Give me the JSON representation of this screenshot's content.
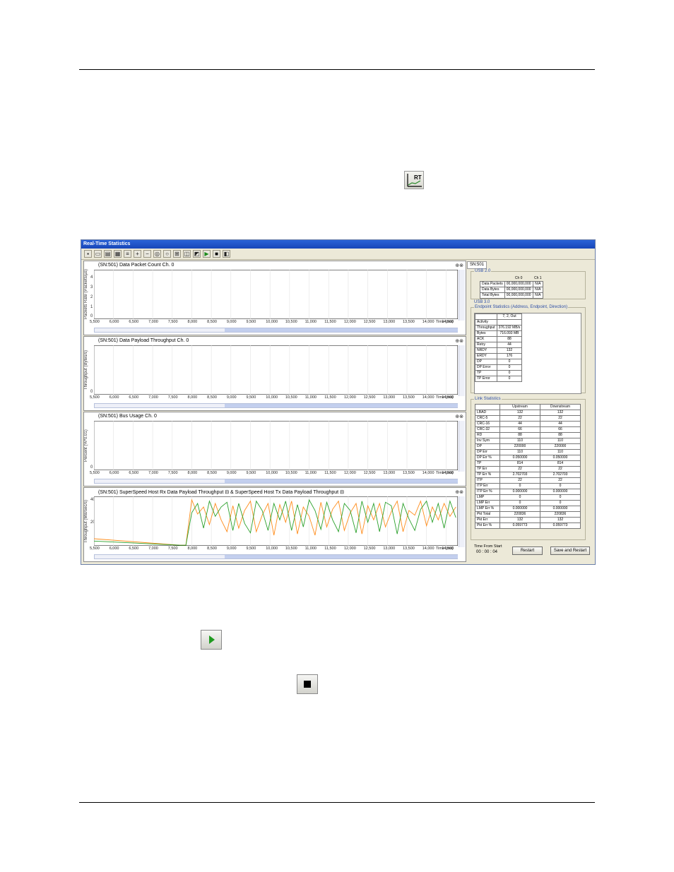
{
  "window": {
    "title": "Real-Time Statistics",
    "tab": "SN:501"
  },
  "x_ticks": [
    "5,500",
    "6,000",
    "6,500",
    "7,000",
    "7,500",
    "8,000",
    "8,500",
    "9,000",
    "9,500",
    "10,000",
    "10,500",
    "11,000",
    "11,500",
    "12,000",
    "12,500",
    "13,000",
    "13,500",
    "14,000",
    "14,500"
  ],
  "x_unit_label": "Time (ms)",
  "panels": [
    {
      "title": "(SN:501) Data Packet Count Ch. 0",
      "ylabel": "Packets Rate (Packets/µs)"
    },
    {
      "title": "(SN:501) Data Payload Throughput Ch. 0",
      "ylabel": "Throughput (Bytes/s)"
    },
    {
      "title": "(SN:501) Bus Usage Ch. 0",
      "ylabel": "Percent (%*0.01)"
    },
    {
      "title": "(SN:501) SuperSpeed Host Rx Data Payload Throughput ⊟ & SuperSpeed Host Tx Data Payload Throughput ⊟",
      "ylabel": "Throughput (MB/sec/s)"
    }
  ],
  "usb20": {
    "label": "USB 2.0",
    "headers": [
      "",
      "Ch 0",
      "Ch 1"
    ],
    "rows": [
      [
        "Data Packets",
        "00,000,000,000",
        "N/A"
      ],
      [
        "Data Bytes",
        "00,000,000,000",
        "N/A"
      ],
      [
        "Total Bytes",
        "00,000,000,000",
        "N/A"
      ]
    ]
  },
  "usb30": {
    "label": "USB 3.0",
    "endpoint_label": "Endpoint Statistics (Address, Endpoint, Direction)",
    "endpoint_header": "7, 2, Out",
    "endpoint_rows": [
      [
        "Activity",
        ""
      ],
      [
        "Throughput",
        "376.192 MB/s"
      ],
      [
        "Bytes",
        "716.093 MB"
      ],
      [
        "ACK",
        "88"
      ],
      [
        "Retry",
        "44"
      ],
      [
        "NRDY",
        "132"
      ],
      [
        "ERDY",
        "176"
      ],
      [
        "DP",
        "0"
      ],
      [
        "DP Error",
        "0"
      ],
      [
        "TP",
        "0"
      ],
      [
        "TP Error",
        "0"
      ]
    ],
    "link_label": "Link Statistics",
    "link_headers": [
      "",
      "Upstream",
      "Downstream"
    ],
    "link_rows": [
      [
        "LBAD",
        "132",
        "132"
      ],
      [
        "CRC-5",
        "22",
        "22"
      ],
      [
        "CRC-16",
        "44",
        "44"
      ],
      [
        "CRC-32",
        "66",
        "66"
      ],
      [
        "RD",
        "88",
        "88"
      ],
      [
        "Inv Sym",
        "110",
        "110"
      ],
      [
        "DP",
        "220000",
        "220000"
      ],
      [
        "DP Err",
        "110",
        "110"
      ],
      [
        "DP Err %",
        "0.050000",
        "0.050000"
      ],
      [
        "TP",
        "814",
        "814"
      ],
      [
        "TP Err",
        "22",
        "22"
      ],
      [
        "TP Err %",
        "2.702703",
        "2.702703"
      ],
      [
        "ITP",
        "22",
        "22"
      ],
      [
        "ITP Err",
        "0",
        "0"
      ],
      [
        "ITP Err %",
        "0.000000",
        "0.000000"
      ],
      [
        "LMP",
        "0",
        "0"
      ],
      [
        "LMP Err",
        "0",
        "0"
      ],
      [
        "LMP Err %",
        "0.000000",
        "0.000000"
      ],
      [
        "Pkt Total",
        "220836",
        "220836"
      ],
      [
        "Pkt Err",
        "132",
        "132"
      ],
      [
        "Pkt Err %",
        "0.059773",
        "0.059773"
      ]
    ]
  },
  "footer": {
    "time_label": "Time From Start",
    "time_value": "00 : 00 : 04",
    "restart": "Restart",
    "save_restart": "Save and Restart"
  },
  "chart_data": [
    {
      "type": "line",
      "title": "(SN:501) Data Packet Count Ch. 0",
      "ylabel": "Packets Rate (Packets/µs)",
      "xlabel": "Time (ms)",
      "xlim": [
        5500,
        14800
      ],
      "ylim": [
        0,
        4.5
      ],
      "y_ticks": [
        0,
        1,
        2,
        3,
        4
      ],
      "series": []
    },
    {
      "type": "line",
      "title": "(SN:501) Data Payload Throughput Ch. 0",
      "ylabel": "Throughput (Bytes/s)",
      "xlabel": "Time (ms)",
      "xlim": [
        5500,
        14800
      ],
      "ylim": [
        0,
        1
      ],
      "y_ticks": [
        0
      ],
      "series": []
    },
    {
      "type": "line",
      "title": "(SN:501) Bus Usage Ch. 0",
      "ylabel": "Percent (%*0.01)",
      "xlabel": "Time (ms)",
      "xlim": [
        5500,
        14800
      ],
      "ylim": [
        0,
        1
      ],
      "y_ticks": [
        0
      ],
      "series": []
    },
    {
      "type": "line",
      "title": "(SN:501) SuperSpeed Host Rx Data Payload Throughput & SuperSpeed Host Tx Data Payload Throughput",
      "ylabel": "Throughput (MB/sec/s)",
      "xlabel": "Time (ms)",
      "xlim": [
        5500,
        14800
      ],
      "ylim": [
        0,
        420
      ],
      "y_ticks": [
        200,
        400
      ],
      "series": [
        {
          "color": "#ff8c1a",
          "x": [
            5500,
            7700,
            7850,
            8000,
            8150,
            8300,
            8450,
            8600,
            8750,
            8900,
            9050,
            9200,
            9350,
            9500,
            9650,
            9800,
            9950,
            10100,
            10250,
            10400,
            10550,
            10700,
            10850,
            11000,
            11150,
            11300,
            11450,
            11600,
            11750,
            11900,
            12050,
            12200,
            12350,
            12500,
            12650,
            12800,
            12950,
            13100,
            13250,
            13400,
            13550,
            13700,
            13850,
            14000,
            14150,
            14300,
            14450,
            14600,
            14750
          ],
          "y": [
            60,
            5,
            5,
            390,
            270,
            330,
            180,
            360,
            220,
            120,
            340,
            150,
            300,
            380,
            120,
            260,
            360,
            90,
            350,
            200,
            380,
            100,
            330,
            250,
            90,
            370,
            160,
            310,
            380,
            130,
            280,
            360,
            100,
            340,
            220,
            360,
            160,
            290,
            380,
            120,
            300,
            260,
            380,
            170,
            330,
            220,
            360,
            250,
            330
          ]
        },
        {
          "color": "#2aa02a",
          "x": [
            5500,
            7700,
            7850,
            8000,
            8150,
            8300,
            8450,
            8600,
            8750,
            8900,
            9050,
            9200,
            9350,
            9500,
            9650,
            9800,
            9950,
            10100,
            10250,
            10400,
            10550,
            10700,
            10850,
            11000,
            11150,
            11300,
            11450,
            11600,
            11750,
            11900,
            12050,
            12200,
            12350,
            12500,
            12650,
            12800,
            12950,
            13100,
            13250,
            13400,
            13550,
            13700,
            13850,
            14000,
            14150,
            14300,
            14450,
            14600,
            14750
          ],
          "y": [
            40,
            5,
            5,
            280,
            360,
            150,
            380,
            250,
            330,
            370,
            130,
            360,
            190,
            110,
            380,
            300,
            130,
            360,
            220,
            380,
            130,
            350,
            160,
            390,
            300,
            140,
            370,
            220,
            120,
            360,
            300,
            110,
            380,
            200,
            360,
            120,
            370,
            340,
            100,
            360,
            230,
            130,
            310,
            380,
            200,
            360,
            150,
            380,
            240
          ]
        }
      ]
    }
  ]
}
